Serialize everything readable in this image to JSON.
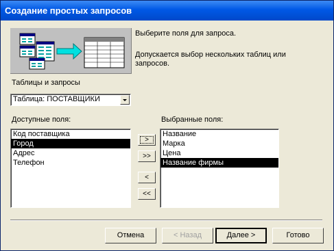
{
  "window": {
    "title": "Создание простых запросов"
  },
  "intro": {
    "line1": "Выберите поля для запроса.",
    "line2": "Допускается выбор нескольких таблиц или запросов."
  },
  "tables": {
    "label": "Таблицы и запросы",
    "selected": "Таблица: ПОСТАВЩИКИ"
  },
  "available": {
    "label": "Доступные поля:",
    "items": [
      "Код поставщика",
      "Город",
      "Адрес",
      "Телефон"
    ],
    "selected_index": 1
  },
  "chosen": {
    "label": "Выбранные поля:",
    "items": [
      "Название",
      "Марка",
      "Цена",
      "Название фирмы"
    ],
    "selected_index": 3
  },
  "move_buttons": {
    "add_one": ">",
    "add_all": ">>",
    "remove_one": "<",
    "remove_all": "<<"
  },
  "buttons": {
    "cancel": "Отмена",
    "back": "< Назад",
    "next": "Далее >",
    "finish": "Готово"
  },
  "colors": {
    "title_bar": "#0058e6",
    "selection": "#000000",
    "dialog_bg": "#ece9d8"
  }
}
